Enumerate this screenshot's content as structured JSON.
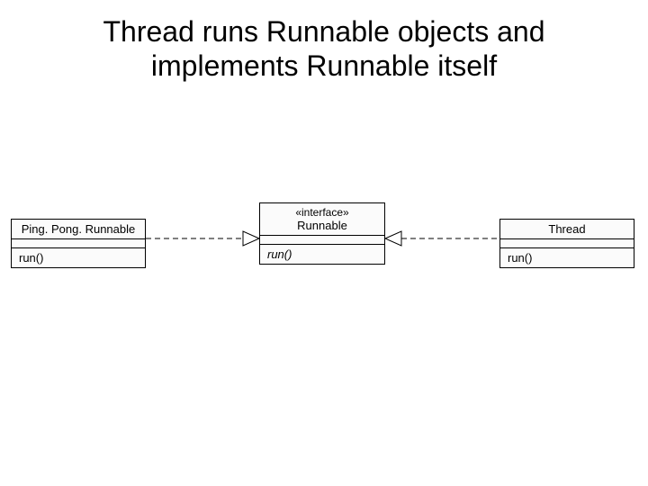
{
  "title": "Thread runs Runnable objects and implements Runnable itself",
  "classes": {
    "left": {
      "name": "Ping. Pong. Runnable",
      "op": "run()"
    },
    "mid": {
      "stereotype": "«interface»",
      "name": "Runnable",
      "op": "run()"
    },
    "right": {
      "name": "Thread",
      "op": "run()"
    }
  },
  "chart_data": {
    "type": "uml-class-diagram",
    "classes": [
      {
        "id": "PingPongRunnable",
        "name": "Ping. Pong. Runnable",
        "stereotype": null,
        "operations": [
          "run()"
        ],
        "abstract": false
      },
      {
        "id": "Runnable",
        "name": "Runnable",
        "stereotype": "«interface»",
        "operations": [
          "run()"
        ],
        "abstract": true
      },
      {
        "id": "Thread",
        "name": "Thread",
        "stereotype": null,
        "operations": [
          "run()"
        ],
        "abstract": false
      }
    ],
    "relationships": [
      {
        "from": "PingPongRunnable",
        "to": "Runnable",
        "type": "realization"
      },
      {
        "from": "Thread",
        "to": "Runnable",
        "type": "realization"
      }
    ]
  }
}
